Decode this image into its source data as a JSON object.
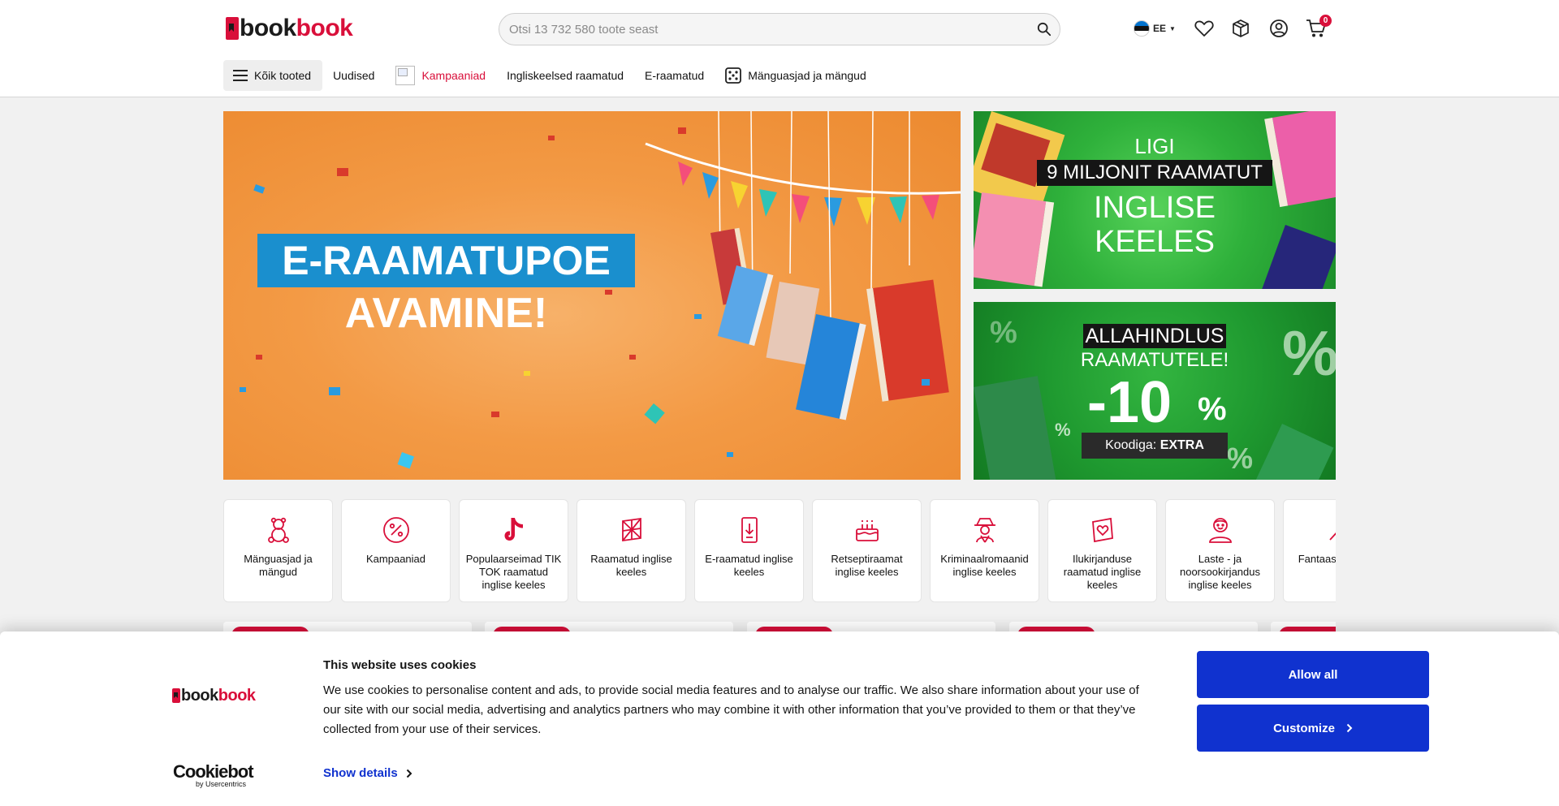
{
  "header": {
    "logo": {
      "part1": "book",
      "part2": "book"
    },
    "search": {
      "placeholder": "Otsi 13 732 580 toote seast"
    },
    "language": {
      "code": "EE"
    },
    "cart_count": "0",
    "icons": [
      "search-icon",
      "estonia-flag-icon",
      "heart-icon",
      "package-icon",
      "user-icon",
      "cart-icon"
    ]
  },
  "nav": {
    "all_products": "Kõik tooted",
    "items": [
      "Uudised",
      "Kampaaniad",
      "Ingliskeelsed raamatud",
      "E-raamatud",
      "Mänguasjad ja mängud"
    ]
  },
  "banners": {
    "main": {
      "line1": "E-RAAMATUPOE",
      "line2": "AVAMINE!"
    },
    "side1": {
      "line1": "LIGI",
      "line2": "9 MILJONIT RAAMATUT",
      "line3": "INGLISE",
      "line4": "KEELES"
    },
    "side2": {
      "line1": "ALLAHINDLUS",
      "line2": "RAAMATUTELE!",
      "discount": "-10",
      "percent": "%",
      "code_label": "Koodiga:",
      "code": "EXTRA"
    }
  },
  "categories": [
    {
      "label": "Mänguasjad ja mängud",
      "icon": "teddy-bear-icon"
    },
    {
      "label": "Kampaaniad",
      "icon": "percent-icon"
    },
    {
      "label": "Populaarseimad TIK TOK raamatud inglise keeles",
      "icon": "tiktok-icon"
    },
    {
      "label": "Raamatud inglise keeles",
      "icon": "uk-book-icon"
    },
    {
      "label": "E-raamatud inglise keeles",
      "icon": "ebook-icon"
    },
    {
      "label": "Retseptiraamat inglise keeles",
      "icon": "cake-icon"
    },
    {
      "label": "Kriminaalromaanid inglise keeles",
      "icon": "detective-icon"
    },
    {
      "label": "Ilukirjanduse raamatud inglise keeles",
      "icon": "heart-book-icon"
    },
    {
      "label": "Laste - ja noorsookirjandus inglise keeles",
      "icon": "child-icon"
    },
    {
      "label": "Fantaasia inglise",
      "icon": "fantasy-icon"
    }
  ],
  "cookie": {
    "logo": {
      "part1": "book",
      "part2": "book"
    },
    "title": "This website uses cookies",
    "text": "We use cookies to personalise content and ads, to provide social media features and to analyse our traffic. We also share information about your use of our site with our social media, advertising and analytics partners who may combine it with other information that you’ve provided to them or that they’ve collected from your use of their services.",
    "show_details": "Show details",
    "allow_all": "Allow all",
    "customize": "Customize",
    "powered_main": "Cookiebot",
    "powered_sub": "by Usercentrics"
  },
  "colors": {
    "brand_red": "#d90f3a",
    "cookie_blue": "#1032cf",
    "banner_orange": "#f39a45",
    "banner_green": "#2fb13b",
    "banner_title_blue": "#1a8fce"
  }
}
